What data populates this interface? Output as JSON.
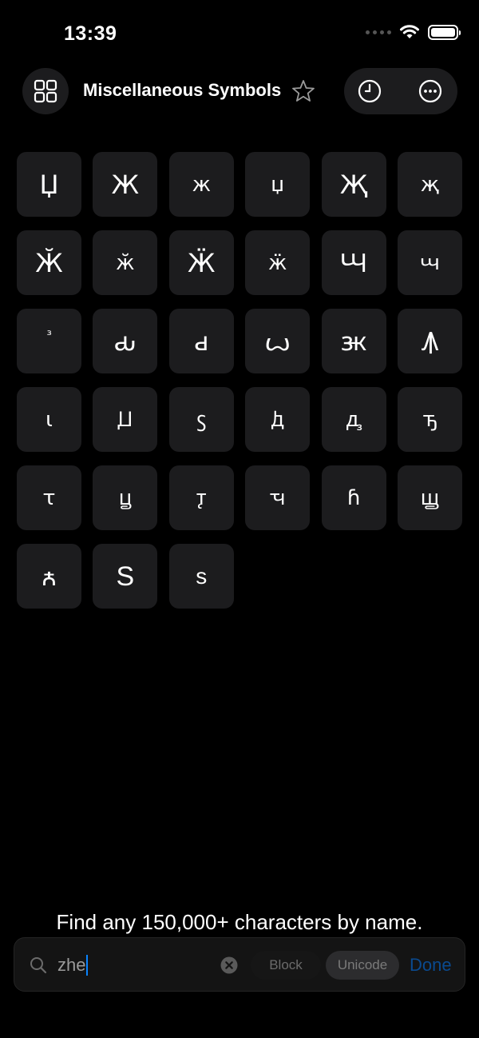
{
  "status_bar": {
    "time": "13:39"
  },
  "header": {
    "title": "Miscellaneous Symbols",
    "grid_icon": "grid-icon",
    "favorite_icon": "star-icon",
    "history_icon": "clock-icon",
    "more_icon": "ellipsis-icon"
  },
  "glyphs": [
    "Џ",
    "Ж",
    "ж",
    "џ",
    "Җ",
    "җ",
    "Ӂ",
    "ӂ",
    "Ӝ",
    "ӝ",
    "Ꚇ",
    "ꚇ",
    "ⷥ",
    "ԃ",
    "ԁ",
    "ꙍ",
    "ꚅ",
    "Ꙟ",
    "ꙇ",
    "Ꙡ",
    "ꚃ",
    "ꚁ",
    "ꚉ",
    "ꚋ",
    "ꚍ",
    "ꚏ",
    "ꚑ",
    "ꚓ",
    "ꚕ",
    "ꚗ",
    "ꙉ",
    "Ѕ",
    "ѕ"
  ],
  "hint": "Find any 150,000+ characters by name.",
  "search": {
    "query": "zhe",
    "scope_block": "Block",
    "scope_unicode": "Unicode",
    "done": "Done",
    "search_icon": "magnifier-icon",
    "clear_icon": "clear-icon"
  },
  "colors": {
    "background": "#000000",
    "cell": "#1c1c1e",
    "accent": "#0a84ff"
  }
}
